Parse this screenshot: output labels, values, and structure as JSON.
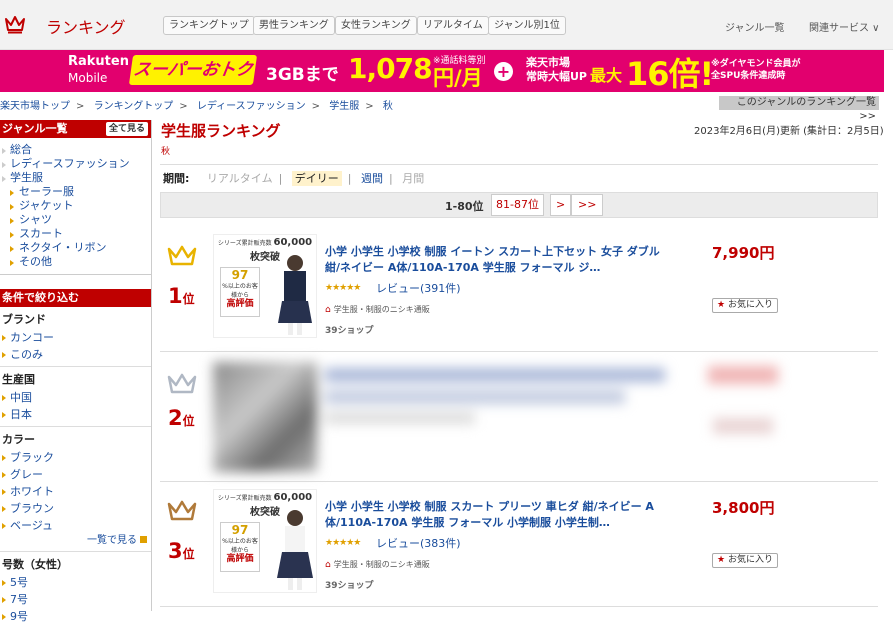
{
  "header": {
    "title": "ランキング",
    "nav": [
      "ランキングトップ",
      "男性ランキング",
      "女性ランキング",
      "リアルタイム",
      "ジャンル別1位"
    ],
    "genre_list": "ジャンル一覧",
    "related": "関連サービス ∨"
  },
  "banner": {
    "brand": "Rakuten",
    "brand_sub": "Mobile",
    "super": "スーパーおトク",
    "data": "3GBまで",
    "price": "1,078",
    "note1": "※通話料等別",
    "yen": "円/月",
    "plus": "+",
    "ichiba1": "楽天市場",
    "ichiba2": "常時大幅UP",
    "max": "最大",
    "times": "16倍!",
    "note2a": "※ダイヤモンド会員が",
    "note2b": "全SPU条件達成時"
  },
  "breadcrumb": [
    "楽天市場トップ",
    "ランキングトップ",
    "レディースファッション",
    "学生服",
    "秋"
  ],
  "breadcrumb_sep": ">",
  "genre_ranking_button": "このジャンルのランキング一覧 >>",
  "sidebar": {
    "genre_header": "ジャンル一覧",
    "all_button": "全て見る",
    "genres": [
      {
        "label": "総合",
        "level": 1
      },
      {
        "label": "レディースファッション",
        "level": 1
      },
      {
        "label": "学生服",
        "level": 1
      },
      {
        "label": "セーラー服",
        "level": 2
      },
      {
        "label": "ジャケット",
        "level": 2
      },
      {
        "label": "シャツ",
        "level": 2
      },
      {
        "label": "スカート",
        "level": 2
      },
      {
        "label": "ネクタイ・リボン",
        "level": 2
      },
      {
        "label": "その他",
        "level": 2
      }
    ],
    "filter_header": "条件で絞り込む",
    "brand_title": "ブランド",
    "brands": [
      "カンコー",
      "このみ"
    ],
    "origin_title": "生産国",
    "origins": [
      "中国",
      "日本"
    ],
    "color_title": "カラー",
    "colors": [
      "ブラック",
      "グレー",
      "ホワイト",
      "ブラウン",
      "ベージュ"
    ],
    "more_link": "一覧で見る",
    "size_title": "号数（女性）",
    "sizes": [
      "5号",
      "7号",
      "9号"
    ]
  },
  "main": {
    "title": "学生服ランキング",
    "subtitle": "秋",
    "update": "2023年2月6日(月)更新 (集計日：2月5日)",
    "period_label": "期間:",
    "periods": [
      "リアルタイム",
      "デイリー",
      "週間",
      "月間"
    ],
    "period_sep": "|",
    "pager_current": "1-80位",
    "pager_next_range": "81-87位",
    "pager_next": ">",
    "pager_last": ">>"
  },
  "items": [
    {
      "rank": "1",
      "rank_suffix": "位",
      "name": "小学 小学生 小学校 制服 イートン スカート上下セット 女子 ダブル 紺/ネイビー A体/110A-170A 学生服 フォーマル ジ…",
      "stars": "★★★★★",
      "reviews": "レビュー(391件)",
      "shop": "学生服・制服のニシキ通販",
      "shop_logo": "39ショップ",
      "price": "7,990円",
      "fav": "お気に入り",
      "badge_top": "シリーズ累計販売数",
      "badge_count": "60,000枚突破",
      "badge_pct": "97",
      "badge_mid": "%以上のお客様から",
      "badge_eval": "高評価",
      "crown_color": "#e8b300"
    },
    {
      "rank": "2",
      "rank_suffix": "位",
      "crown_color": "#b0b8c4"
    },
    {
      "rank": "3",
      "rank_suffix": "位",
      "name": "小学 小学生 小学校 制服 スカート プリーツ 車ヒダ 紺/ネイビー A体/110A-170A 学生服 フォーマル 小学制服 小学生制…",
      "stars": "★★★★★",
      "reviews": "レビュー(383件)",
      "shop": "学生服・制服のニシキ通販",
      "shop_logo": "39ショップ",
      "price": "3,800円",
      "fav": "お気に入り",
      "badge_top": "シリーズ累計販売数",
      "badge_count": "60,000枚突破",
      "badge_pct": "97",
      "badge_mid": "%以上のお客様から",
      "badge_eval": "高評価",
      "crown_color": "#b07a3a"
    }
  ]
}
